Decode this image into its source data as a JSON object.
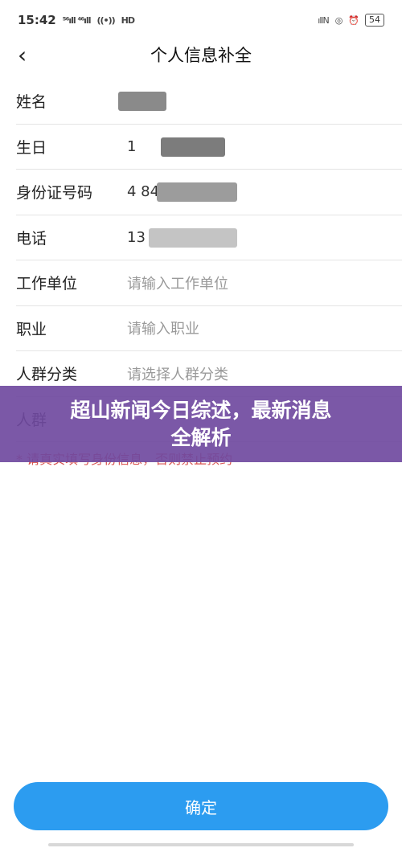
{
  "status_bar": {
    "time": "15:42",
    "left_signal": "⁵⁶ıll ⁴⁶ıll",
    "hd": "HD",
    "battery": "54"
  },
  "header": {
    "title": "个人信息补全"
  },
  "form": {
    "rows": [
      {
        "label": "姓名",
        "value": ""
      },
      {
        "label": "生日",
        "value": "1"
      },
      {
        "label": "身份证号码",
        "value": "4                    84"
      },
      {
        "label": "电话",
        "value": "13"
      },
      {
        "label": "工作单位",
        "placeholder": "请输入工作单位"
      },
      {
        "label": "职业",
        "placeholder": "请输入职业"
      },
      {
        "label": "人群分类",
        "placeholder": "请选择人群分类"
      },
      {
        "label": "人群",
        "placeholder": ""
      }
    ]
  },
  "notice": "* 请真实填写身份信息，否则禁止预约",
  "banner": {
    "line1": "超山新闻今日综述，最新消息",
    "line2": "全解析"
  },
  "confirm_label": "确定",
  "colors": {
    "accent": "#2c9cf0",
    "banner": "#704aa0",
    "notice": "#d9534f"
  }
}
